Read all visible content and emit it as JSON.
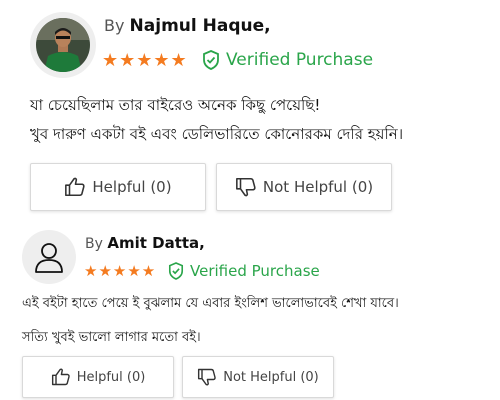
{
  "reviews": [
    {
      "by_label": "By",
      "author": "Najmul Haque,",
      "stars": "★★★★★",
      "rating": 5,
      "verified_label": "Verified Purchase",
      "body_lines": [
        "যা চেয়েছিলাম তার বাইরেও অনেক কিছু পেয়েছি!",
        "খুব দারুণ একটা বই এবং ডেলিভারিতে কোনোরকম দেরি হয়নি।"
      ],
      "helpful_label": "Helpful (0)",
      "not_helpful_label": "Not Helpful (0)",
      "avatar_icon": "user-photo"
    },
    {
      "by_label": "By",
      "author": "Amit Datta,",
      "stars": "★★★★★",
      "rating": 5,
      "verified_label": "Verified Purchase",
      "body_lines": [
        "এই বইটা হাতে পেয়ে ই বুঝলাম যে এবার ইংলিশ ভালোভাবেই শেখা যাবে।",
        "সত্যি খুবই ভালো লাগার মতো বই।"
      ],
      "helpful_label": "Helpful (0)",
      "not_helpful_label": "Not Helpful (0)",
      "avatar_icon": "user-outline-icon"
    }
  ],
  "colors": {
    "stars": "#f47b20",
    "verified": "#2aa54a"
  }
}
